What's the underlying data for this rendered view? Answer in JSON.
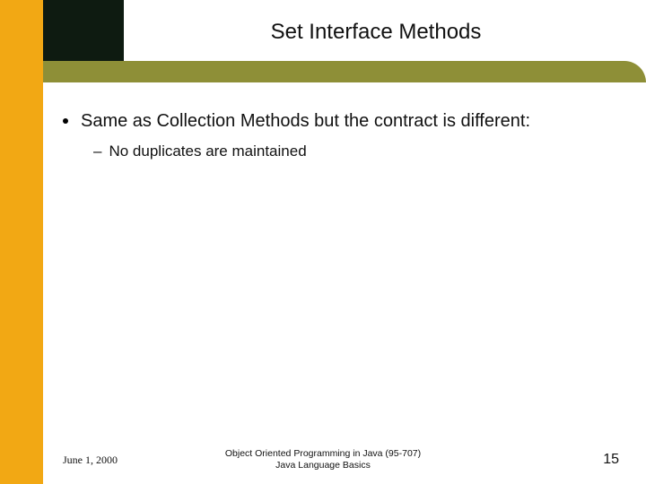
{
  "slide": {
    "title": "Set Interface Methods",
    "bullets": [
      {
        "text": "Same as Collection Methods but the contract is different:",
        "sub": [
          "No duplicates are maintained"
        ]
      }
    ]
  },
  "footer": {
    "date": "June 1, 2000",
    "center_line1": "Object Oriented Programming in Java  (95-707)",
    "center_line2": "Java Language Basics",
    "page": "15"
  }
}
